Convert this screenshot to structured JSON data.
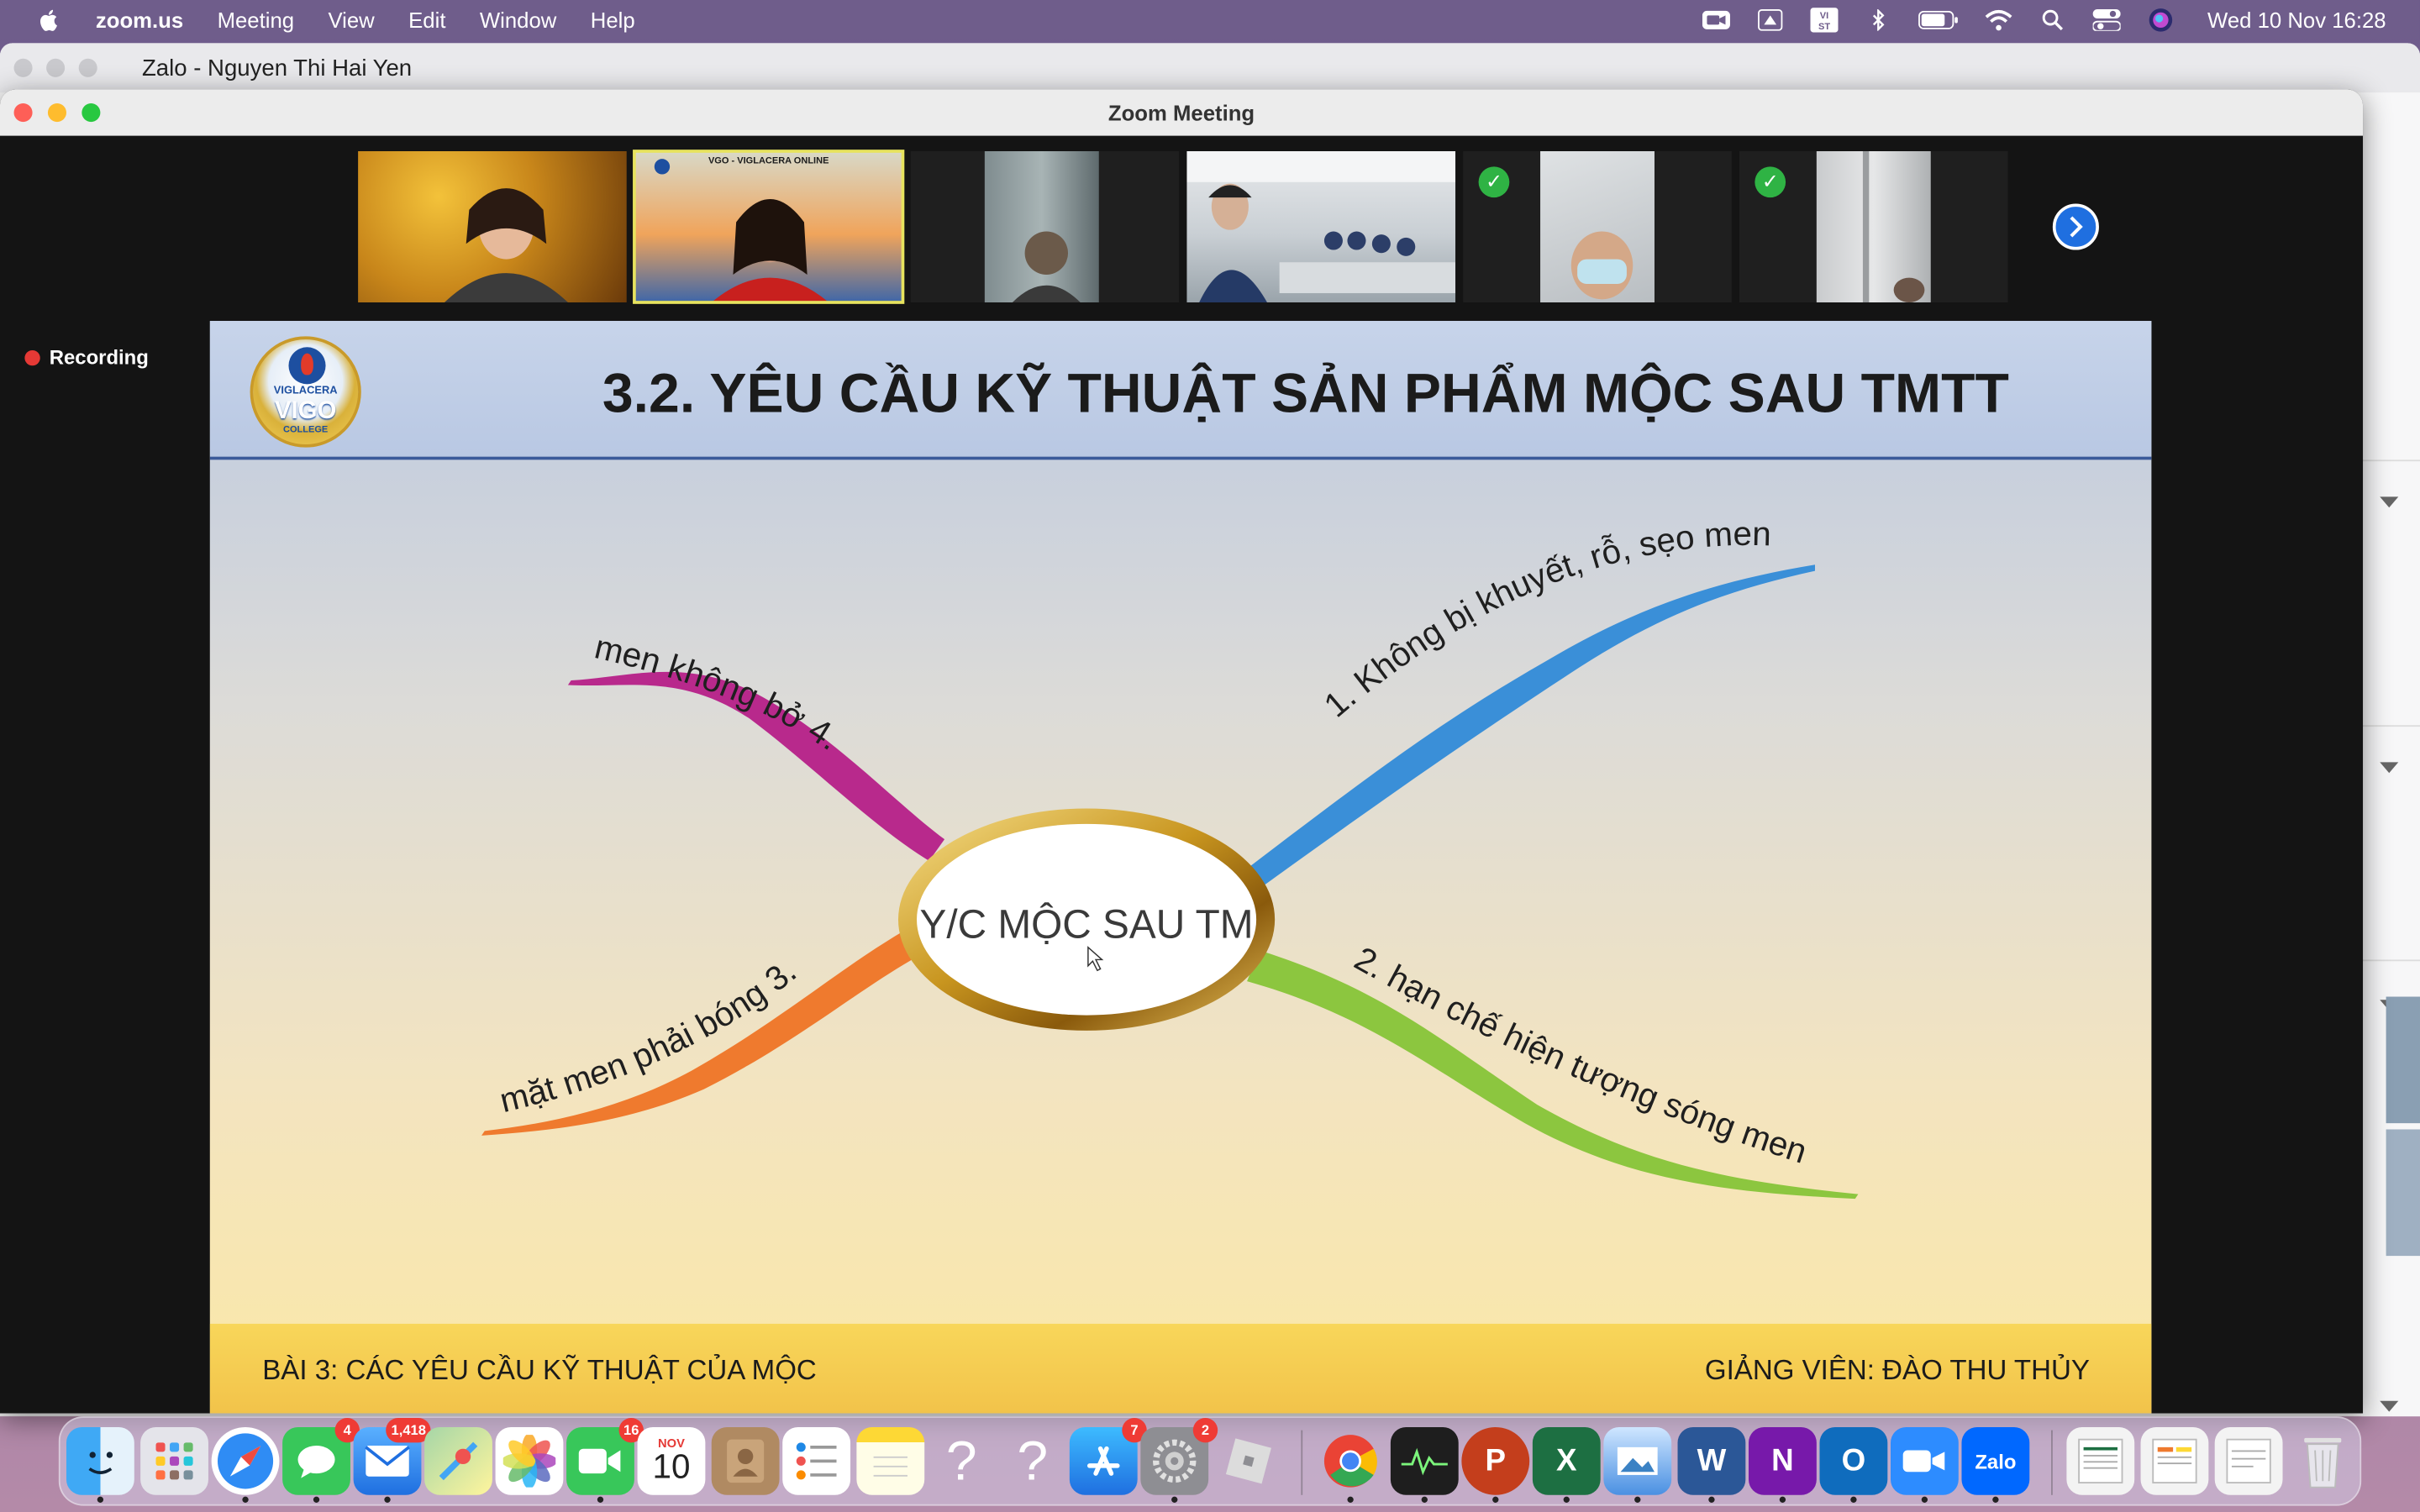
{
  "menubar": {
    "app_name": "zoom.us",
    "menus": [
      "Meeting",
      "View",
      "Edit",
      "Window",
      "Help"
    ],
    "clock": "Wed 10 Nov  16:28",
    "status_icons": [
      "zoom-icon",
      "airdrop-icon",
      "vst-icon",
      "bluetooth-icon",
      "battery-icon",
      "wifi-icon",
      "search-icon",
      "control-center-icon",
      "siri-icon"
    ],
    "vst_label": "VI\nST"
  },
  "zalo": {
    "title": "Zalo - Nguyen Thi Hai Yen"
  },
  "zoom": {
    "window_title": "Zoom Meeting",
    "recording_label": "Recording",
    "tiles": [
      {
        "kind": "autumn",
        "checked": false,
        "active": false
      },
      {
        "kind": "banner",
        "checked": false,
        "active": true,
        "banner_text": "VGO - VIGLACERA ONLINE"
      },
      {
        "kind": "dark-room",
        "checked": false,
        "active": false
      },
      {
        "kind": "meeting-room",
        "checked": false,
        "active": false
      },
      {
        "kind": "mask",
        "checked": true,
        "active": false
      },
      {
        "kind": "wall",
        "checked": true,
        "active": false
      }
    ]
  },
  "slide": {
    "title": "3.2. YÊU CẦU KỸ THUẬT SẢN PHẨM MỘC SAU TMTT",
    "logo_top": "VIGLACERA",
    "logo_brand": "VIGO",
    "logo_sub": "COLLEGE",
    "center_label": "Y/C MỘC SAU TM",
    "branches": {
      "b1": "1. Không bị khuyết, rỗ, sẹo men",
      "b2": "2. hạn chế hiện tượng sóng men",
      "b3": "mặt men phải bóng 3.",
      "b4": "men không bở 4."
    },
    "footer_left": "BÀI 3: CÁC YÊU CẦU KỸ THUẬT CỦA MỘC",
    "footer_right": "GIẢNG VIÊN: ĐÀO THU THỦY",
    "colors": {
      "b1": "#3a8fd8",
      "b2": "#8cc63f",
      "b3": "#ef7a2e",
      "b4": "#b8298c"
    }
  },
  "dock": {
    "messages_badge": "4",
    "mail_badge": "1,418",
    "facetime_badge": "16",
    "calendar_month": "NOV",
    "calendar_day": "10",
    "appstore_badge": "7",
    "settings_badge": "2",
    "zalo_label": "Zalo"
  }
}
